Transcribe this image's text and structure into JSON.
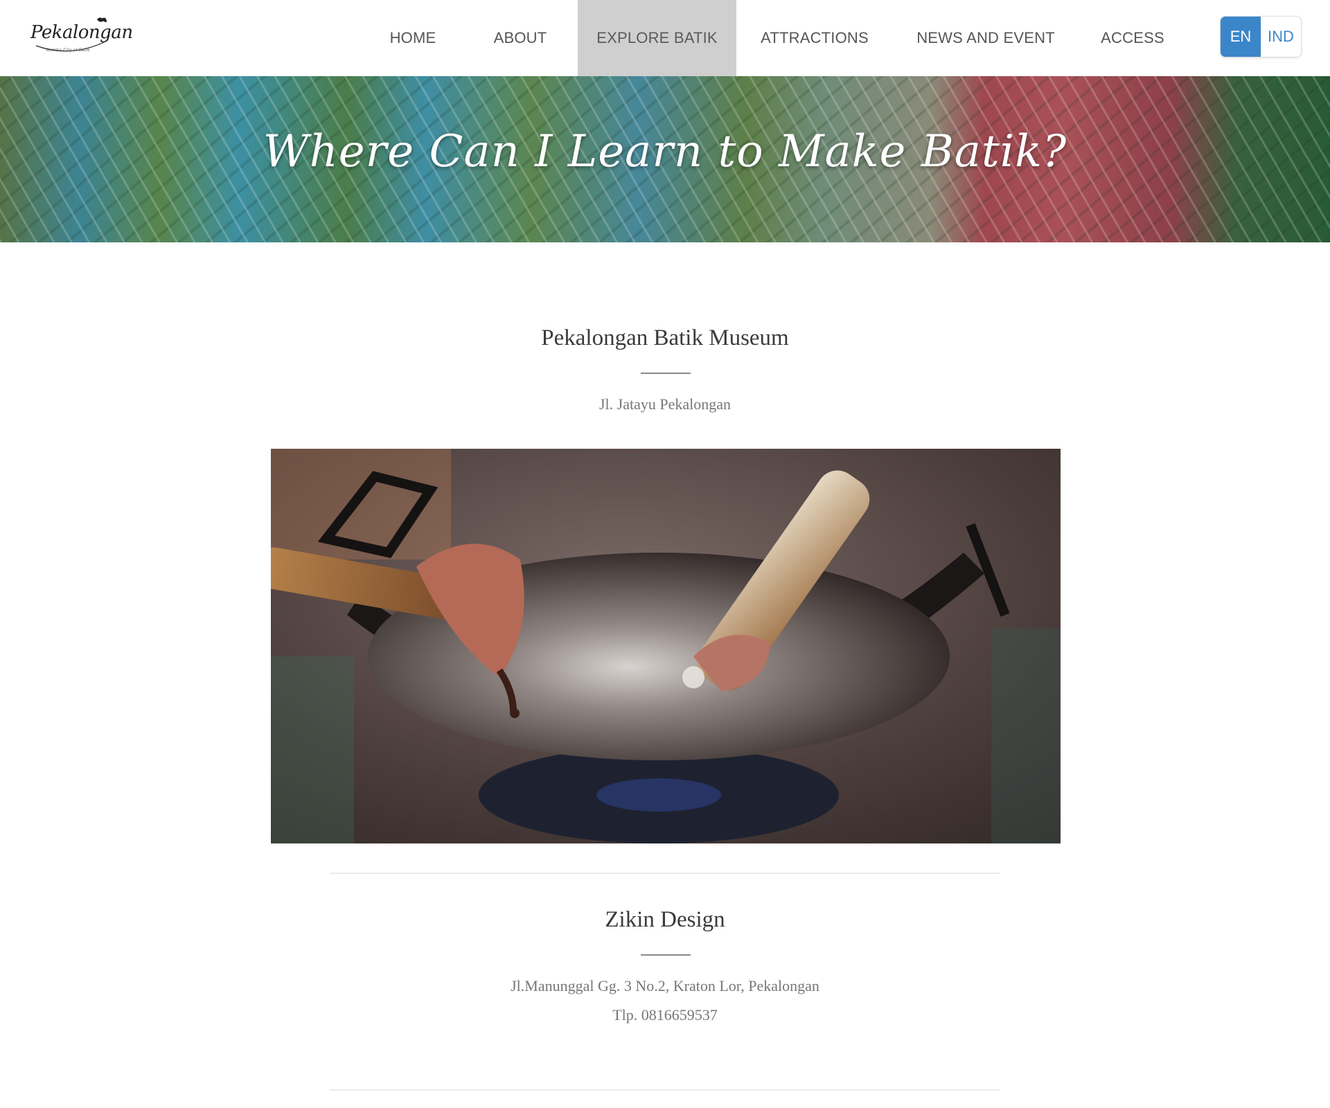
{
  "header": {
    "logo_text": "Pekalongan",
    "logo_tagline": "World's City of Batik",
    "nav": [
      {
        "label": "HOME",
        "active": false
      },
      {
        "label": "ABOUT",
        "active": false
      },
      {
        "label": "EXPLORE BATIK",
        "active": true
      },
      {
        "label": "ATTRACTIONS",
        "active": false
      },
      {
        "label": "NEWS AND EVENT",
        "active": false
      },
      {
        "label": "ACCESS",
        "active": false
      }
    ],
    "lang": {
      "en": "EN",
      "ind": "IND",
      "selected": "EN"
    }
  },
  "hero": {
    "title": "Where Can I Learn to Make Batik?"
  },
  "places": [
    {
      "name": "Pekalongan Batik Museum",
      "address": "Jl. Jatayu Pekalongan",
      "image": "canting-wax-pan-photo"
    },
    {
      "name": "Zikin Design",
      "address": "Jl.Manunggal Gg. 3 No.2, Kraton Lor, Pekalongan",
      "phone": "Tlp. 0816659537"
    }
  ],
  "colors": {
    "accent": "#3b86c9",
    "active_nav": "#cfcfcf"
  }
}
